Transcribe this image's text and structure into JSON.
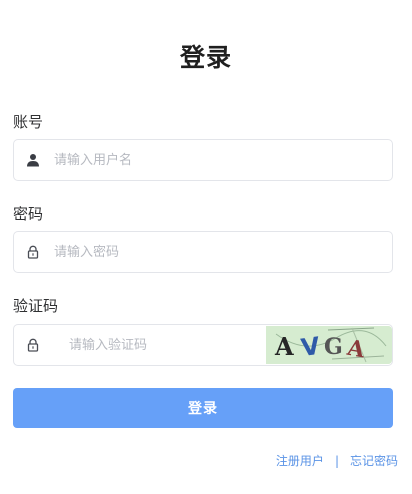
{
  "page": {
    "title": "登录"
  },
  "form": {
    "account": {
      "label": "账号",
      "placeholder": "请输入用户名",
      "icon": "user-icon"
    },
    "password": {
      "label": "密码",
      "placeholder": "请输入密码",
      "icon": "lock-icon"
    },
    "captcha": {
      "label": "验证码",
      "placeholder": "请输入验证码",
      "icon": "lock-icon",
      "image_text": "AVGA"
    },
    "submit_label": "登录"
  },
  "links": {
    "register": "注册用户",
    "separator": "|",
    "forgot": "忘记密码"
  },
  "colors": {
    "primary": "#66a0f8",
    "link": "#5a93e6",
    "captcha_bg": "#d6ecd0"
  }
}
